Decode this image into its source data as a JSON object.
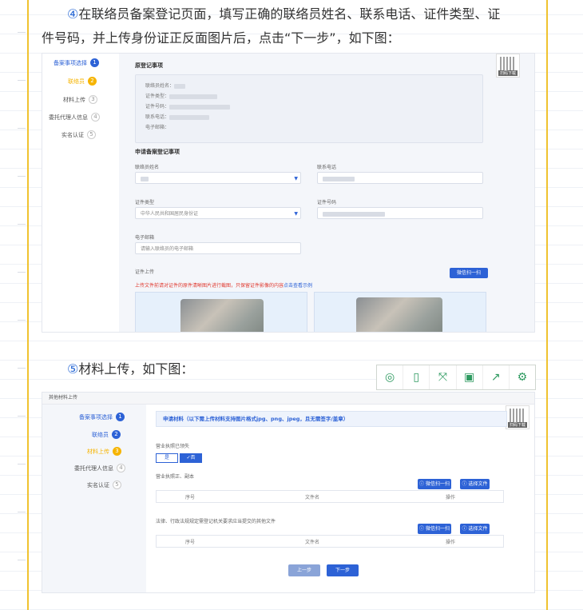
{
  "intro": {
    "step4_num": "④",
    "step4_line1": "在联络员备案登记页面，填写正确的联络员姓名、联系电话、证件类型、证",
    "step4_line2": "件号码，并上传身份证正反面图片后，点击“下一步”，如下图：",
    "step5_num": "⑤",
    "step5_text": "材料上传，如下图："
  },
  "shot1": {
    "steps": [
      "备案事项选择",
      "联络员",
      "材料上传",
      "委托代理人信息",
      "实名认证"
    ],
    "step_nums": [
      "1",
      "2",
      "3",
      "4",
      "5"
    ],
    "qr_tag": "扫码下载",
    "orig_title": "原登记事项",
    "orig_rows": [
      "联络员姓名：",
      "证件类型：",
      "证件号码：",
      "联系电话：",
      "电子邮箱："
    ],
    "apply_title": "申请备案登记事项",
    "name_label": "联络员姓名",
    "phone_label": "联系电话",
    "idtype_label": "证件类型",
    "idtype_value": "中华人民共和国居民身份证",
    "idno_label": "证件号码",
    "email_label": "电子邮箱",
    "email_placeholder": "请输入联络员的电子邮箱",
    "upload_label": "证件上传",
    "scan_button": "微信扫一扫",
    "warn_text": "上传文件前请对证件的原件清晰图片进行截图，只保留证件影像的内容",
    "warn_link": "点击查看示例"
  },
  "toolbar": {
    "icons": [
      "search-circle-icon",
      "phone-icon",
      "fullscreen-icon",
      "save-icon",
      "share-icon",
      "settings-icon"
    ],
    "glyphs": [
      "◎",
      "▯",
      "⤧",
      "▣",
      "↗",
      "⚙"
    ]
  },
  "shot2": {
    "header": "其他材料上传",
    "steps": [
      "备案事项选择",
      "联络员",
      "材料上传",
      "委托代理人信息",
      "实名认证"
    ],
    "step_nums": [
      "1",
      "2",
      "3",
      "4",
      "5"
    ],
    "qr_tag": "扫码下载",
    "notice": "申请材料（以下需上传材料支持图片格式jpg、png、jpeg，且无需签字/盖章）",
    "license_q": "营业执照已领失",
    "no_label": "是",
    "yes_label": "✓否",
    "sec1": "营业执照正、副本",
    "sec2": "法律、行政法规规定需登记机关要求应当提交的其他文件",
    "scan_button": "微信扫一扫",
    "choose_button": "选择文件",
    "cols": [
      "序号",
      "文件名",
      "操作"
    ],
    "prev": "上一步",
    "next": "下一步"
  }
}
